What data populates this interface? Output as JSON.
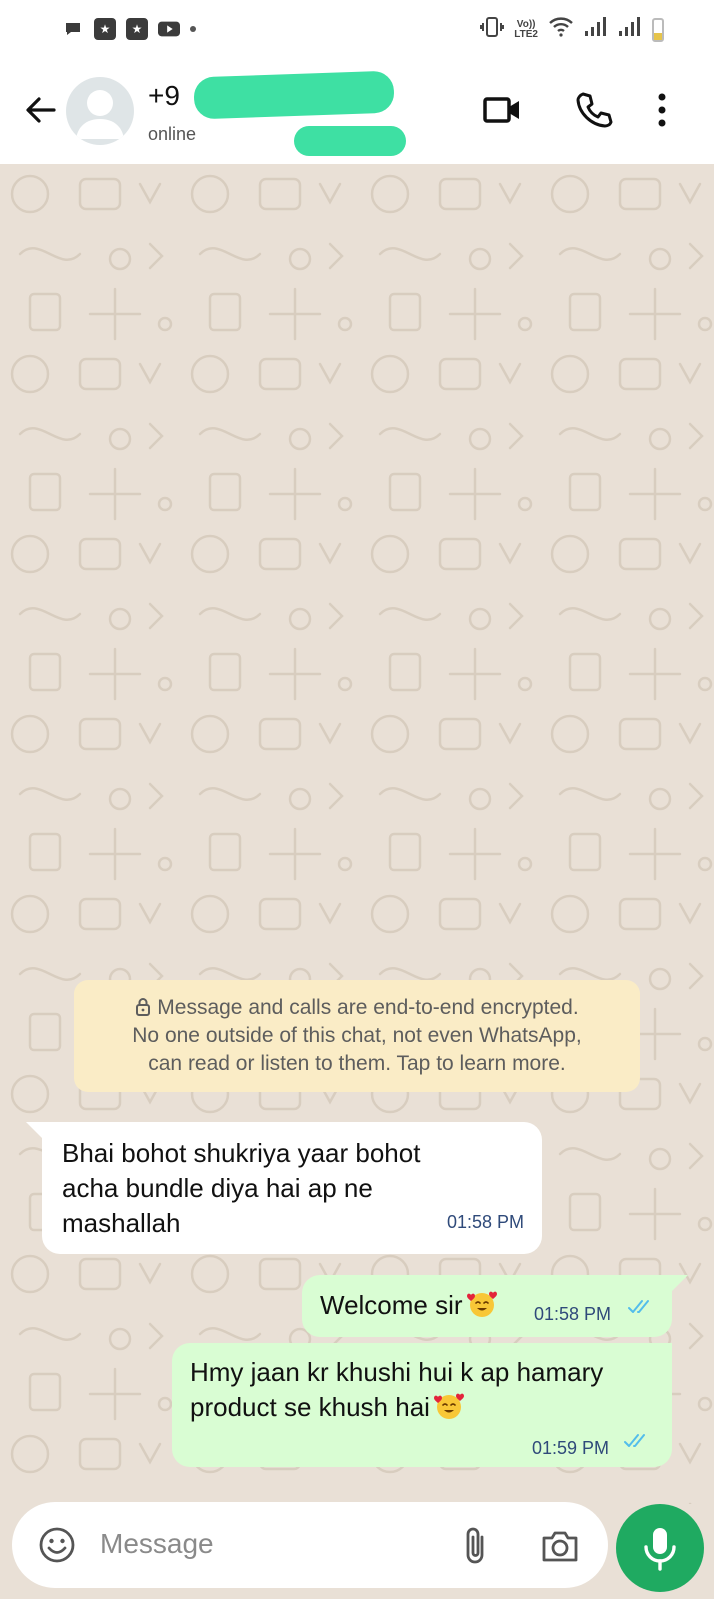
{
  "status_bar": {
    "icons_left": [
      "chat-bubble-icon",
      "app-icon",
      "app-icon",
      "youtube-icon",
      "dot-icon"
    ],
    "network_label_top": "Vo))",
    "network_label_bottom": "LTE2",
    "icons_right": [
      "vibrate-icon",
      "wifi-icon",
      "signal-icon",
      "signal-icon",
      "battery-icon"
    ],
    "battery_level": 0.35
  },
  "header": {
    "contact_name": "+9",
    "status": "online"
  },
  "encryption_notice": {
    "line1": "Message and calls are end-to-end encrypted.",
    "line2": "No one outside of this chat, not even WhatsApp,",
    "line3": "can read or listen to them. Tap to learn more."
  },
  "messages": [
    {
      "direction": "incoming",
      "text": "Bhai bohot shukriya yaar bohot acha bundle diya hai ap ne mashallah",
      "time": "01:58 PM"
    },
    {
      "direction": "outgoing",
      "text": "Welcome sir",
      "emoji": "smiling-face-with-hearts",
      "time": "01:58 PM",
      "status": "read"
    },
    {
      "direction": "outgoing",
      "text": "Hmy jaan kr khushi hui k ap hamary product se khush hai",
      "emoji": "smiling-face-with-hearts",
      "time": "01:59 PM",
      "status": "read"
    }
  ],
  "composer": {
    "placeholder": "Message"
  },
  "colors": {
    "chat_background": "#e9e0d6",
    "incoming_bubble": "#ffffff",
    "outgoing_bubble": "#d9fdd3",
    "notice_background": "#faecc6",
    "mic_button": "#1faa61",
    "read_ticks": "#53bdeb",
    "redaction": "#3ee0a3"
  }
}
